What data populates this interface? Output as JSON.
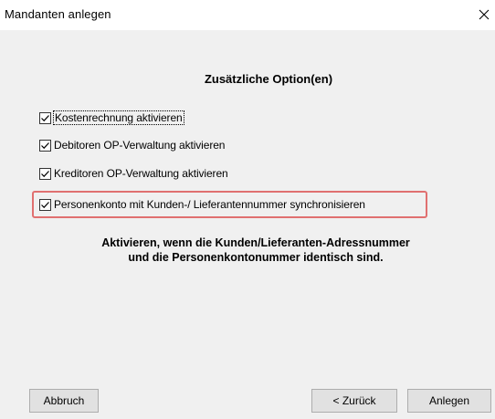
{
  "window": {
    "title": "Mandanten anlegen",
    "close_icon": "close-icon"
  },
  "section": {
    "heading": "Zusätzliche Option(en)"
  },
  "options": [
    {
      "label": "Kostenrechnung aktivieren",
      "checked": true
    },
    {
      "label": "Debitoren OP-Verwaltung aktivieren",
      "checked": true
    },
    {
      "label": "Kreditoren OP-Verwaltung aktivieren",
      "checked": true
    },
    {
      "label": "Personenkonto mit Kunden-/ Lieferantennummer synchronisieren",
      "checked": true
    }
  ],
  "info": {
    "line1": "Aktivieren, wenn die Kunden/Lieferanten-Adressnummer",
    "line2": "und die Personenkontonummer identisch sind."
  },
  "buttons": {
    "cancel": "Abbruch",
    "back": "< Zurück",
    "create": "Anlegen"
  },
  "colors": {
    "highlight": "#e07070",
    "background": "#f0f0f0"
  }
}
